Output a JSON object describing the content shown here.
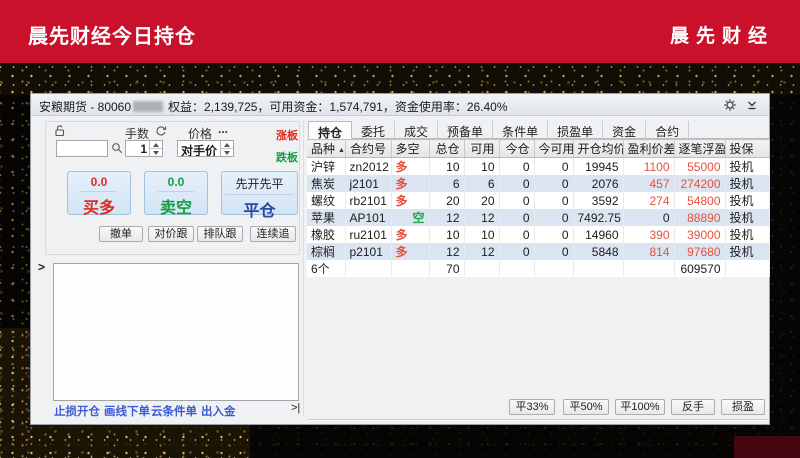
{
  "colors": {
    "banner_red": "#c9112b",
    "up_red": "#e8503c",
    "down_green": "#22a44c",
    "link_blue": "#3c5bd6",
    "close_blue": "#2746a5",
    "stripe_blue": "#dbe5f1"
  },
  "banner": {
    "left_title": "晨先财经今日持仓",
    "right_title": "晨先财经"
  },
  "window": {
    "title_prefix": "安粮期货 - 80060",
    "title_stats": "权益：2,139,725，可用资金：1,574,791，资金使用率：26.40%",
    "icons": {
      "settings": "gear-icon",
      "collapse": "collapse-icon"
    }
  },
  "order_panel": {
    "lock_icon": "unlock-icon",
    "lots_label": "手数",
    "cycle_icon": "cycle-icon",
    "price_label": "价格",
    "price_more": "...",
    "contract_input_value": "",
    "search_icon": "magnifier-icon",
    "lots_value": "1",
    "price_mode_value": "对手价",
    "limit_up_label": "涨板",
    "limit_down_label": "跌板",
    "buy_price": "0.0",
    "buy_label": "买多",
    "sell_price": "0.0",
    "sell_label": "卖空",
    "close_mode": "先开先平",
    "close_label": "平仓",
    "quick_buttons": [
      "撤单",
      "对价跟",
      "排队跟",
      "连续追"
    ],
    "expand_arrow": ">",
    "links": [
      "止损开仓",
      "画线下单",
      "云条件单",
      "出入金"
    ],
    "links_arrow": ">|"
  },
  "positions": {
    "tabs": [
      "持仓",
      "委托",
      "成交",
      "预备单",
      "条件单",
      "损盈单",
      "资金",
      "合约"
    ],
    "active_tab": "持仓",
    "sort_icon": "▲",
    "columns": [
      "品种",
      "合约号",
      "多空",
      "总仓",
      "可用",
      "今仓",
      "今可用",
      "开仓均价",
      "盈利价差",
      "逐笔浮盈",
      "投保"
    ],
    "rows": [
      {
        "product": "沪锌",
        "contract": "zn2012",
        "side": "多",
        "total": "10",
        "available": "10",
        "today": "0",
        "today_available": "0",
        "avg_price": "19945",
        "profit_diff": "1100",
        "float_profit": "55000",
        "hedge": "投机"
      },
      {
        "product": "焦炭",
        "contract": "j2101",
        "side": "多",
        "total": "6",
        "available": "6",
        "today": "0",
        "today_available": "0",
        "avg_price": "2076",
        "profit_diff": "457",
        "float_profit": "274200",
        "hedge": "投机"
      },
      {
        "product": "螺纹",
        "contract": "rb2101",
        "side": "多",
        "total": "20",
        "available": "20",
        "today": "0",
        "today_available": "0",
        "avg_price": "3592",
        "profit_diff": "274",
        "float_profit": "54800",
        "hedge": "投机"
      },
      {
        "product": "苹果",
        "contract": "AP101",
        "side": "空",
        "total": "12",
        "available": "12",
        "today": "0",
        "today_available": "0",
        "avg_price": "7492.75",
        "profit_diff": "0",
        "float_profit": "88890",
        "hedge": "投机"
      },
      {
        "product": "橡胶",
        "contract": "ru2101",
        "side": "多",
        "total": "10",
        "available": "10",
        "today": "0",
        "today_available": "0",
        "avg_price": "14960",
        "profit_diff": "390",
        "float_profit": "39000",
        "hedge": "投机"
      },
      {
        "product": "棕榈",
        "contract": "p2101",
        "side": "多",
        "total": "12",
        "available": "12",
        "today": "0",
        "today_available": "0",
        "avg_price": "5848",
        "profit_diff": "814",
        "float_profit": "97680",
        "hedge": "投机"
      }
    ],
    "summary": {
      "count": "6个",
      "total": "70",
      "float_profit": "609570"
    },
    "bottom_buttons": [
      "平33%",
      "平50%",
      "平100%",
      "反手",
      "损盈"
    ]
  }
}
